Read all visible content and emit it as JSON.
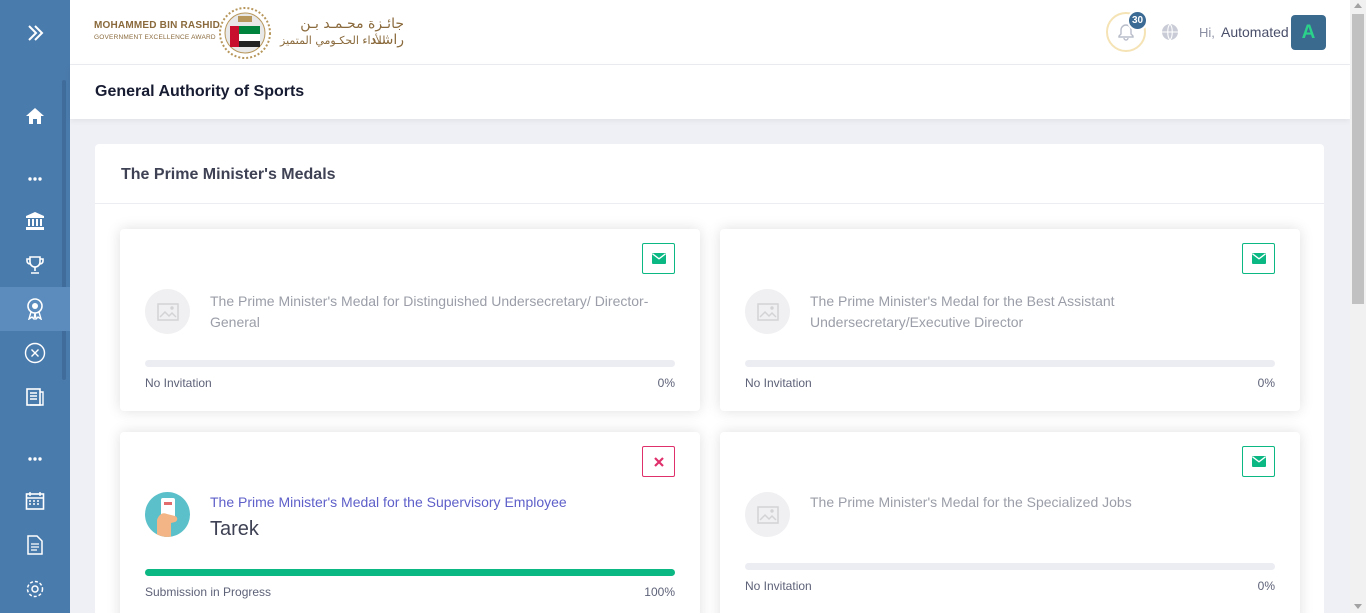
{
  "logo": {
    "en_line1": "MOHAMMED BIN RASHID",
    "en_line2": "GOVERNMENT EXCELLENCE AWARD",
    "ar_line1": "جائـزة محـمـد بـن راشـد",
    "ar_line2": "للأداء الحكـومي المتميز"
  },
  "header": {
    "notification_count": "30",
    "greeting": "Hi,",
    "user_name": "Automated",
    "avatar_letter": "A"
  },
  "sidebar": {
    "icons": [
      "expand-icon",
      "home-icon",
      "more-icon",
      "institution-icon",
      "trophy-icon",
      "medal-icon",
      "cancel-circle-icon",
      "document-icon",
      "more-icon",
      "calendar-icon",
      "file-icon",
      "settings-icon"
    ],
    "active_item": "medal-icon"
  },
  "page": {
    "title": "General Authority of Sports",
    "panel_title": "The Prime Minister's Medals"
  },
  "cards": [
    {
      "title": "The Prime Minister's Medal for Distinguished Undersecretary/ Director-General",
      "action": "mail",
      "status": "No Invitation",
      "percent": "0%",
      "progress": 0
    },
    {
      "title": "The Prime Minister's Medal for the Best Assistant Undersecretary/Executive Director",
      "action": "mail",
      "status": "No Invitation",
      "percent": "0%",
      "progress": 0
    },
    {
      "title": "The Prime Minister's Medal for the Supervisory Employee",
      "person": "Tarek",
      "action": "close",
      "status": "Submission in Progress",
      "percent": "100%",
      "progress": 1.0
    },
    {
      "title": "The Prime Minister's Medal for the Specialized Jobs",
      "action": "mail",
      "status": "No Invitation",
      "percent": "0%",
      "progress": 0
    }
  ],
  "colors": {
    "sidebar": "#4a7bad",
    "success": "#0bb783",
    "danger": "#e0306b",
    "link": "#5e5fc9"
  }
}
